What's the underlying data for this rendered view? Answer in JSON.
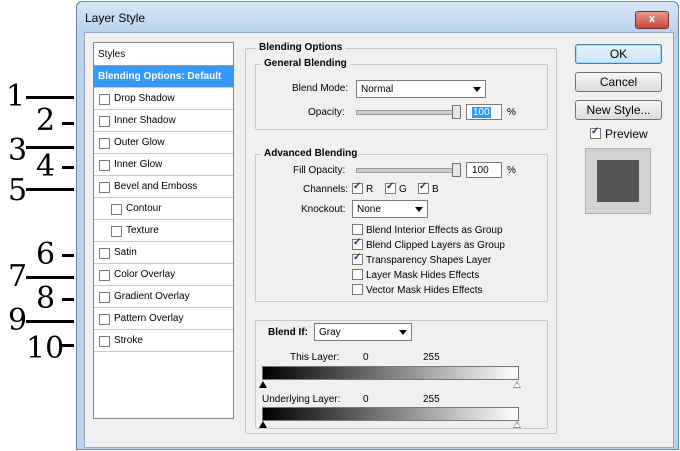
{
  "annotations": [
    "1",
    "2",
    "3",
    "4",
    "5",
    "6",
    "7",
    "8",
    "9",
    "10"
  ],
  "window": {
    "title": "Layer Style",
    "close": "x"
  },
  "styles_list": {
    "header": "Styles",
    "items": [
      {
        "label": "Blending Options: Default",
        "checkbox": false,
        "selected": true
      },
      {
        "label": "Drop Shadow",
        "checkbox": true,
        "checked": false
      },
      {
        "label": "Inner Shadow",
        "checkbox": true,
        "checked": false
      },
      {
        "label": "Outer Glow",
        "checkbox": true,
        "checked": false
      },
      {
        "label": "Inner Glow",
        "checkbox": true,
        "checked": false
      },
      {
        "label": "Bevel and Emboss",
        "checkbox": true,
        "checked": false
      },
      {
        "label": "Contour",
        "checkbox": true,
        "checked": false,
        "indent": true
      },
      {
        "label": "Texture",
        "checkbox": true,
        "checked": false,
        "indent": true
      },
      {
        "label": "Satin",
        "checkbox": true,
        "checked": false
      },
      {
        "label": "Color Overlay",
        "checkbox": true,
        "checked": false
      },
      {
        "label": "Gradient Overlay",
        "checkbox": true,
        "checked": false
      },
      {
        "label": "Pattern Overlay",
        "checkbox": true,
        "checked": false
      },
      {
        "label": "Stroke",
        "checkbox": true,
        "checked": false
      }
    ]
  },
  "blending": {
    "title": "Blending Options",
    "general": {
      "title": "General Blending",
      "blend_mode_label": "Blend Mode:",
      "blend_mode": "Normal",
      "opacity_label": "Opacity:",
      "opacity": "100",
      "opacity_unit": "%"
    },
    "advanced": {
      "title": "Advanced Blending",
      "fill_opacity_label": "Fill Opacity:",
      "fill_opacity": "100",
      "fill_unit": "%",
      "channels_label": "Channels:",
      "channels": [
        {
          "label": "R",
          "checked": true
        },
        {
          "label": "G",
          "checked": true
        },
        {
          "label": "B",
          "checked": true
        }
      ],
      "knockout_label": "Knockout:",
      "knockout": "None",
      "options": [
        {
          "label": "Blend Interior Effects as Group",
          "checked": false
        },
        {
          "label": "Blend Clipped Layers as Group",
          "checked": true
        },
        {
          "label": "Transparency Shapes Layer",
          "checked": true
        },
        {
          "label": "Layer Mask Hides Effects",
          "checked": false
        },
        {
          "label": "Vector Mask Hides Effects",
          "checked": false
        }
      ]
    },
    "blend_if": {
      "label": "Blend If:",
      "channel": "Gray",
      "this_layer_label": "This Layer:",
      "this_low": "0",
      "this_high": "255",
      "underlying_label": "Underlying Layer:",
      "under_low": "0",
      "under_high": "255"
    }
  },
  "buttons": {
    "ok": "OK",
    "cancel": "Cancel",
    "new_style": "New Style..."
  },
  "preview": {
    "label": "Preview",
    "checked": true
  },
  "colors": {
    "selection": "#3399ff",
    "swatch": "#555555"
  }
}
